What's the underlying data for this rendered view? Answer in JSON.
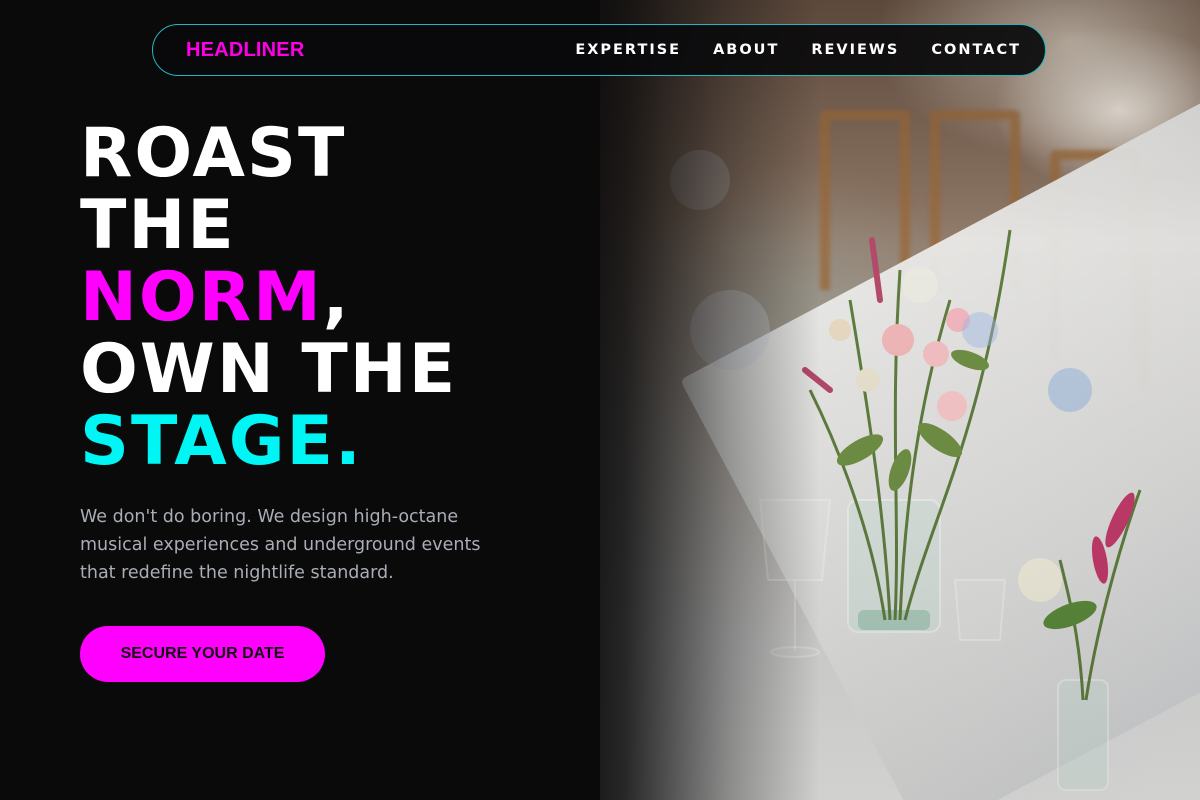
{
  "nav": {
    "logo": "HEADLINER",
    "items": [
      {
        "label": "EXPERTISE"
      },
      {
        "label": "ABOUT"
      },
      {
        "label": "REVIEWS"
      },
      {
        "label": "CONTACT"
      }
    ]
  },
  "hero": {
    "line1": "ROAST",
    "line2": "THE",
    "line3_highlight": "NORM",
    "line3_suffix": ",",
    "line4": "OWN THE",
    "line5": "STAGE."
  },
  "description": "We don't do boring. We design high-octane musical experiences and underground events that redefine the nightlife standard.",
  "cta": {
    "label": "SECURE YOUR DATE"
  },
  "colors": {
    "background": "#0a0a0b",
    "accent_pink": "#ff00ff",
    "accent_cyan": "#00f5f5",
    "nav_border": "#1fb8c2",
    "body_text": "#a9adb5"
  },
  "background_image": {
    "subject": "wedding-table-flowers-photo"
  }
}
